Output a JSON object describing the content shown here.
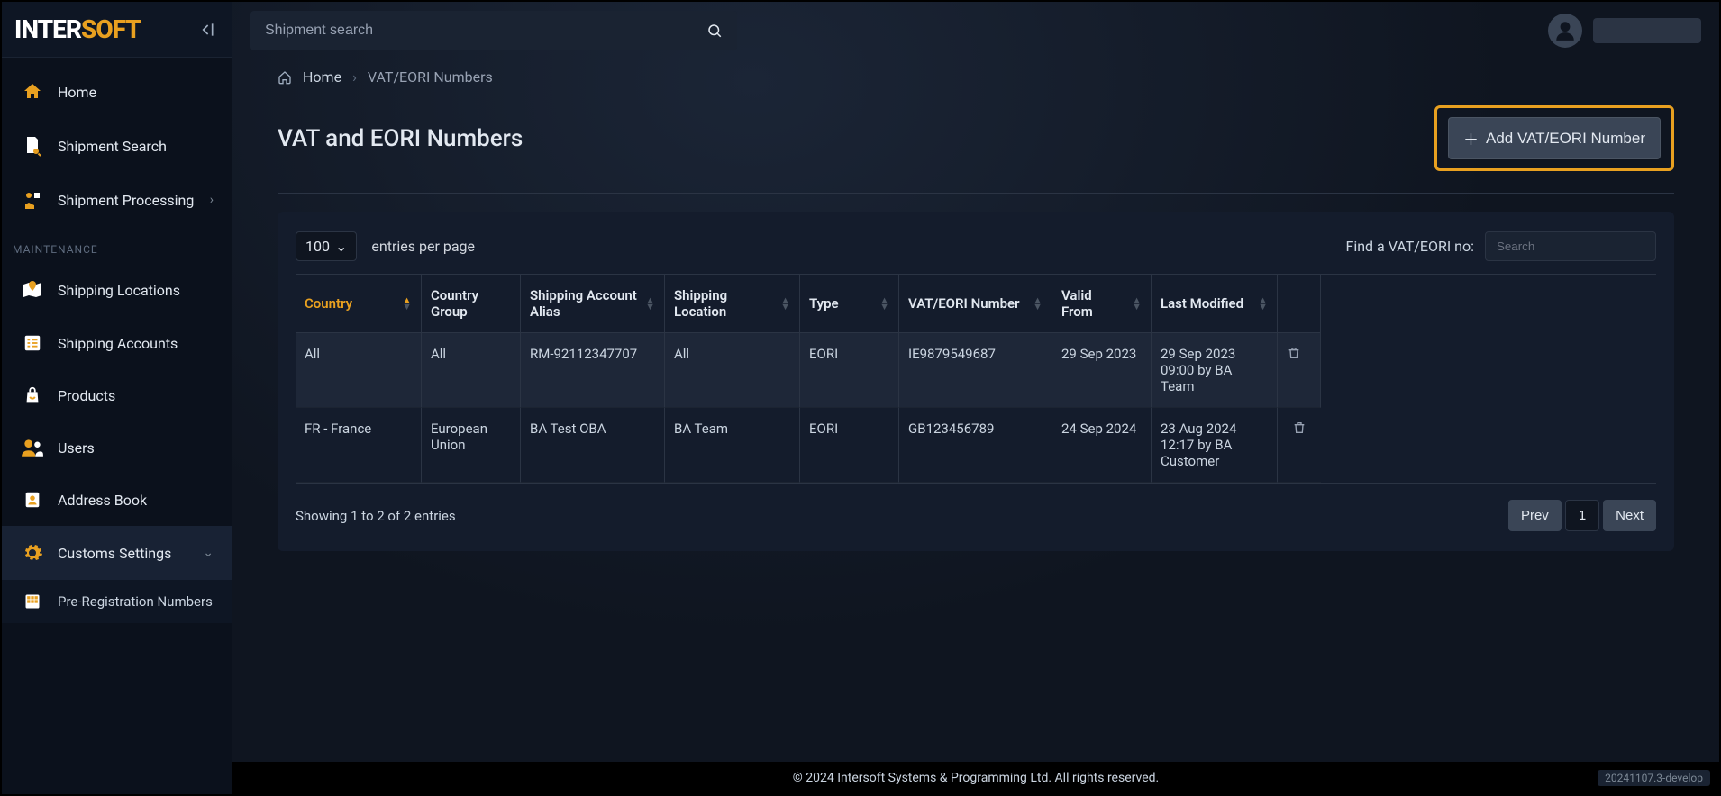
{
  "brand": {
    "white": "INTER",
    "orange": "SOFT"
  },
  "search": {
    "placeholder": "Shipment search"
  },
  "sidebar": {
    "home": "Home",
    "shipment_search": "Shipment Search",
    "shipment_processing": "Shipment Processing",
    "section_label": "MAINTENANCE",
    "shipping_locations": "Shipping Locations",
    "shipping_accounts": "Shipping Accounts",
    "products": "Products",
    "users": "Users",
    "address_book": "Address Book",
    "customs_settings": "Customs Settings",
    "pre_registration": "Pre-Registration Numbers"
  },
  "breadcrumb": {
    "home": "Home",
    "current": "VAT/EORI Numbers"
  },
  "page": {
    "title": "VAT and EORI Numbers",
    "add_button": "Add VAT/EORI Number"
  },
  "table": {
    "page_size": "100",
    "entries_label": "entries per page",
    "filter_label": "Find a VAT/EORI no:",
    "filter_placeholder": "Search",
    "columns": {
      "country": "Country",
      "country_group": "Country Group",
      "account_alias": "Shipping Account Alias",
      "shipping_location": "Shipping Location",
      "type": "Type",
      "vat_eori": "VAT/EORI Number",
      "valid_from": "Valid From",
      "last_modified": "Last Modified"
    },
    "rows": [
      {
        "country": "All",
        "country_group": "All",
        "account_alias": "RM-92112347707",
        "shipping_location": "All",
        "type": "EORI",
        "vat_eori": "IE9879549687",
        "valid_from": "29 Sep 2023",
        "last_modified": "29 Sep 2023 09:00 by BA Team"
      },
      {
        "country": "FR - France",
        "country_group": "European Union",
        "account_alias": "BA Test OBA",
        "shipping_location": "BA Team",
        "type": "EORI",
        "vat_eori": "GB123456789",
        "valid_from": "24 Sep 2024",
        "last_modified": "23 Aug 2024 12:17 by BA Customer"
      }
    ],
    "results_text": "Showing 1 to 2 of 2 entries",
    "pager": {
      "prev": "Prev",
      "page": "1",
      "next": "Next"
    }
  },
  "footer": {
    "copyright": "© 2024 Intersoft Systems & Programming Ltd. All rights reserved.",
    "version": "20241107.3-develop"
  }
}
